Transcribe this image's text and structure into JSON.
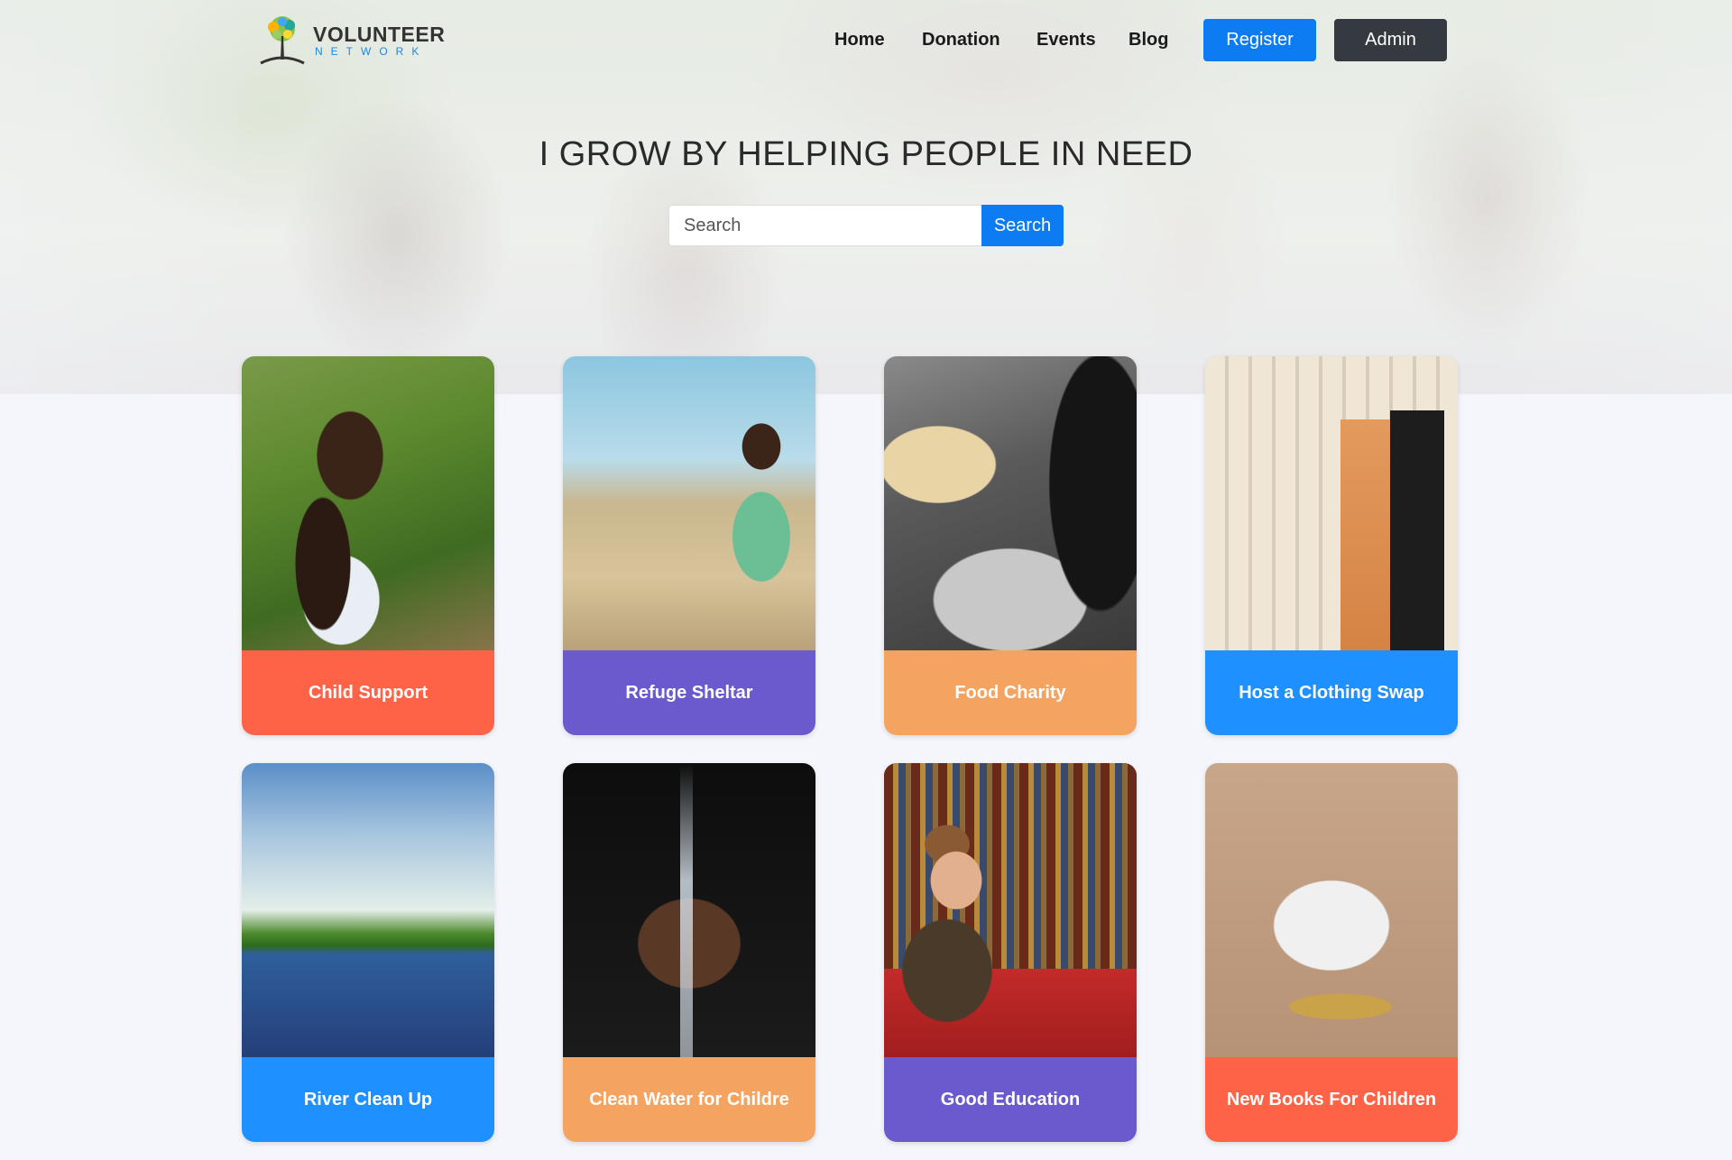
{
  "header": {
    "logo_title": "VOLUNTEER",
    "logo_subtitle": "NETWORK",
    "nav": [
      "Home",
      "Donation",
      "Events",
      "Blog"
    ],
    "register_label": "Register",
    "admin_label": "Admin"
  },
  "hero": {
    "headline": "I GROW BY HELPING PEOPLE IN NEED",
    "search_placeholder": "Search",
    "search_button": "Search"
  },
  "cards": [
    {
      "label": "Child Support",
      "color": "#ff6347"
    },
    {
      "label": "Refuge Sheltar",
      "color": "#6a5acd"
    },
    {
      "label": "Food Charity",
      "color": "#f4a460"
    },
    {
      "label": "Host a Clothing Swap",
      "color": "#1e90ff"
    },
    {
      "label": "River Clean Up",
      "color": "#1e90ff"
    },
    {
      "label": "Clean Water for Childre",
      "color": "#f4a460"
    },
    {
      "label": "Good Education",
      "color": "#6a5acd"
    },
    {
      "label": "New Books For Children",
      "color": "#ff6347"
    }
  ],
  "colors": {
    "primary": "#0d7cf2",
    "dark": "#343a40",
    "background": "#f4f6fb"
  }
}
